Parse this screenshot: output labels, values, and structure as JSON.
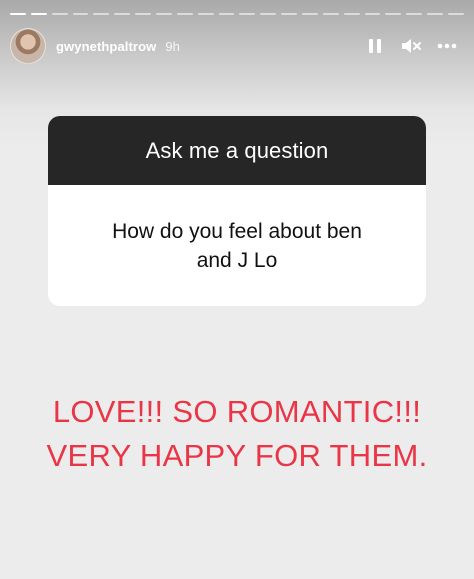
{
  "story": {
    "progress": {
      "segments": 22,
      "completed": 2
    },
    "user": {
      "username": "gwynethpaltrow",
      "time": "9h"
    },
    "icons": {
      "avatar": "profile-photo",
      "pause": "pause-icon",
      "mute": "muted-speaker-icon",
      "more": "more-dots-icon"
    }
  },
  "question_card": {
    "prompt": "Ask me a question",
    "question_line1": "How do you feel about ben",
    "question_line2": "and J Lo"
  },
  "answer": {
    "line1": "LOVE!!! SO ROMANTIC!!!",
    "line2": "VERY HAPPY FOR THEM."
  },
  "colors": {
    "answer_text": "#ea3547",
    "card_header": "#262626",
    "card_body": "#ffffff",
    "background": "#ececec"
  }
}
